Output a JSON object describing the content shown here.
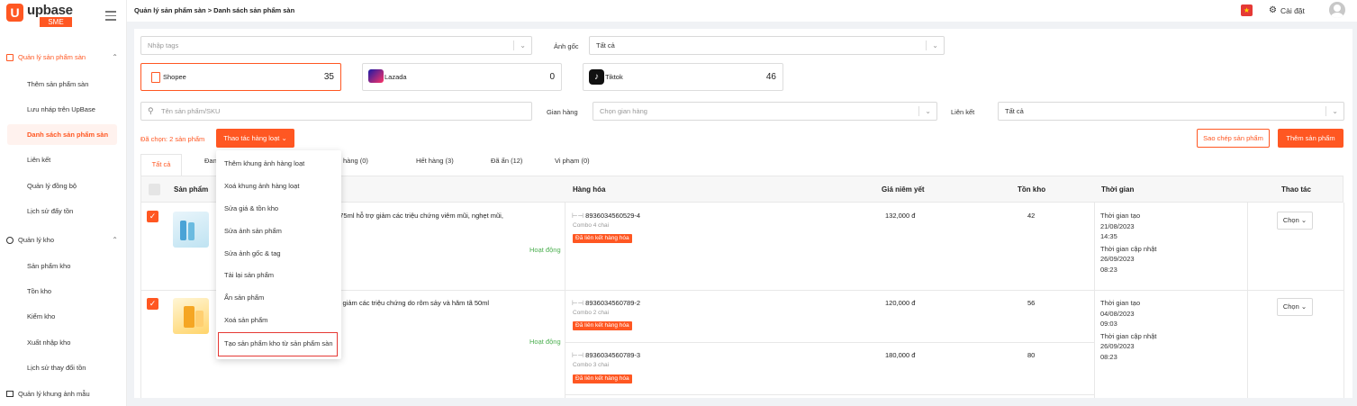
{
  "brand": {
    "name": "upbase",
    "sub": "SME",
    "logo_letter": "U",
    "accent": "#ff5722"
  },
  "breadcrumb": "Quản lý sản phẩm sàn > Danh sách sản phẩm sàn",
  "topbar": {
    "settings_label": "Cài đặt"
  },
  "sidebar": {
    "sec1": "Quản lý sản phẩm sàn",
    "sec1_items": [
      "Thêm sản phẩm sàn",
      "Lưu nháp trên UpBase",
      "Danh sách sản phẩm sàn",
      "Liên kết",
      "Quản lý đồng bộ",
      "Lịch sử đẩy tồn"
    ],
    "sec2": "Quản lý kho",
    "sec2_items": [
      "Sản phẩm kho",
      "Tồn kho",
      "Kiểm kho",
      "Xuất nhập kho",
      "Lịch sử thay đổi tồn"
    ],
    "sec3": "Quản lý khung ảnh mẫu"
  },
  "filters": {
    "tags_placeholder": "Nhập tags",
    "anh_goc_label": "Ảnh gốc",
    "anh_goc_value": "Tất cả",
    "search_placeholder": "Tên sản phẩm/SKU",
    "gian_hang_label": "Gian hàng",
    "gian_hang_placeholder": "Chọn gian hàng",
    "lien_ket_label": "Liên kết",
    "lien_ket_value": "Tất cả"
  },
  "channels": [
    {
      "name": "Shopee",
      "count": "35"
    },
    {
      "name": "Lazada",
      "count": "0"
    },
    {
      "name": "Tiktok",
      "count": "46"
    }
  ],
  "actions": {
    "selected": "Đã chọn: 2 sản phẩm",
    "bulk": "Thao tác hàng loạt",
    "copy": "Sao chép sản phẩm",
    "add": "Thêm sản phẩm"
  },
  "tabs": [
    "Tất cả",
    "Đan",
    "hàng (0)",
    "Hết hàng (3)",
    "Đã ẩn (12)",
    "Vi phạm (0)"
  ],
  "table_headers": {
    "product": "Sản phẩm",
    "goods": "Hàng hóa",
    "price": "Giá niêm yết",
    "stock": "Tồn kho",
    "time": "Thời gian",
    "action": "Thao tác"
  },
  "rows": [
    {
      "name_tail": "7 75ml hỗ trợ giảm các triệu chứng viêm mũi, nghẹt mũi,",
      "status": "Hoạt động",
      "variants": [
        {
          "sku": "8936034560529-4",
          "combo": "Combo 4 chai",
          "linked": "Đã liên kết hàng hóa",
          "price": "132,000 đ",
          "stock": "42"
        }
      ],
      "created_label": "Thời gian tạo",
      "created": "21/08/2023",
      "created_time": "14:35",
      "updated_label": "Thời gian cập nhật",
      "updated": "26/09/2023",
      "updated_time": "08:23",
      "action": "Chọn"
    },
    {
      "name_tail": "rợ giảm các triệu chứng do rôm sảy và hăm tã 50ml",
      "status": "Hoạt động",
      "variants": [
        {
          "sku": "8936034560789-2",
          "combo": "Combo 2 chai",
          "linked": "Đã liên kết hàng hóa",
          "price": "120,000 đ",
          "stock": "56"
        },
        {
          "sku": "8936034560789-3",
          "combo": "Combo 3 chai",
          "linked": "Đã liên kết hàng hóa",
          "price": "180,000 đ",
          "stock": "80"
        }
      ],
      "created_label": "Thời gian tạo",
      "created": "04/08/2023",
      "created_time": "09:03",
      "updated_label": "Thời gian cập nhật",
      "updated": "26/09/2023",
      "updated_time": "08:23",
      "action": "Chọn"
    }
  ],
  "menu": [
    "Thêm khung ảnh hàng loạt",
    "Xoá khung ảnh hàng loạt",
    "Sửa giá & tồn kho",
    "Sửa ảnh sản phẩm",
    "Sửa ảnh gốc & tag",
    "Tải lại sản phẩm",
    "Ẩn sản phẩm",
    "Xoá sản phẩm",
    "Tạo sản phẩm kho từ sản phẩm sàn"
  ]
}
